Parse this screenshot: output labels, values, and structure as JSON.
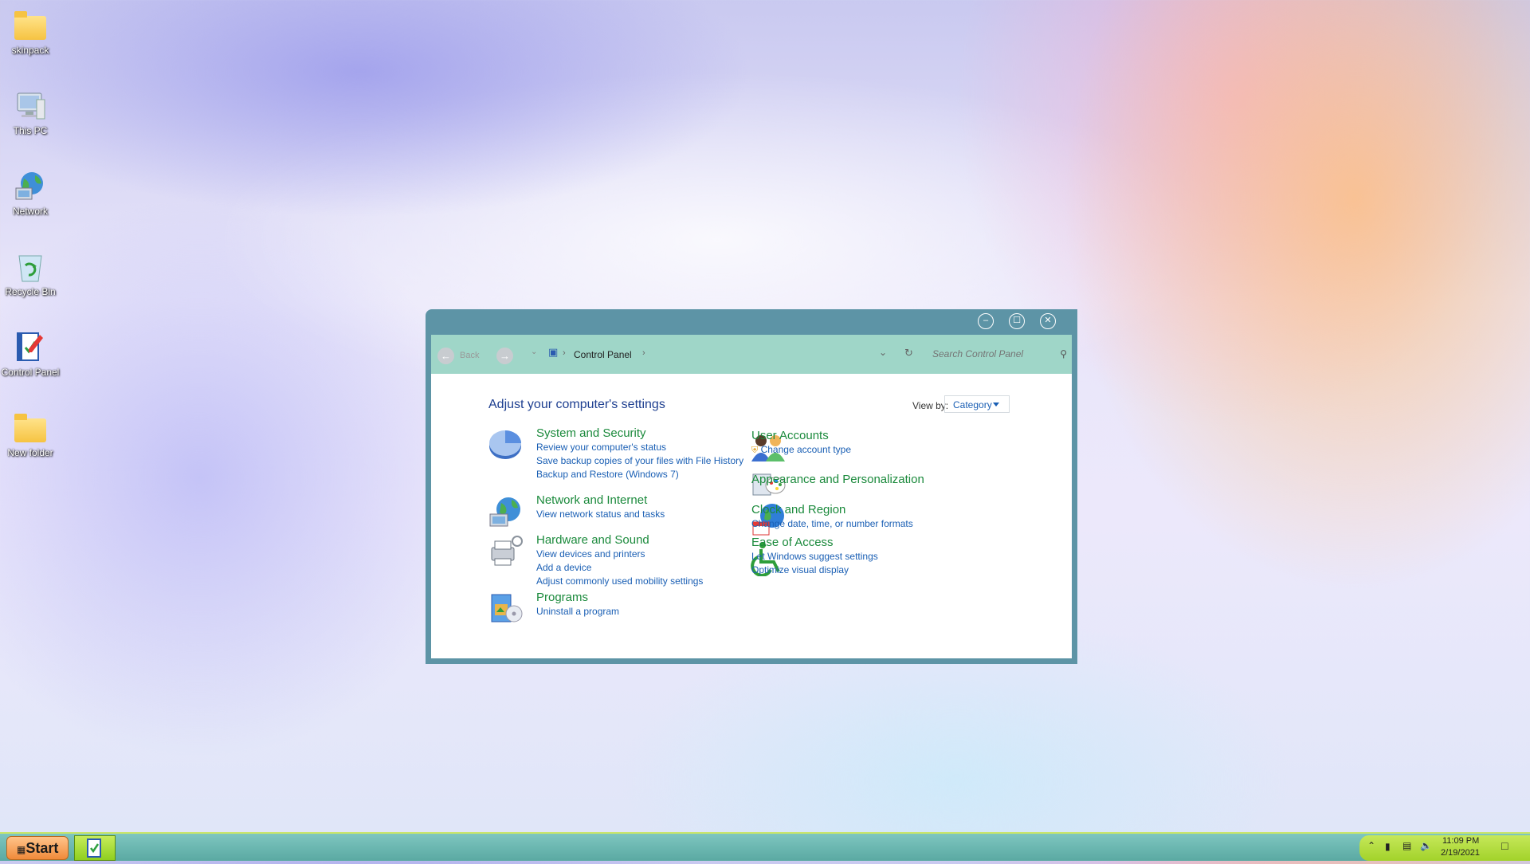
{
  "desktop": {
    "icons": [
      {
        "label": "skinpack",
        "icon": "folder-icon"
      },
      {
        "label": "This PC",
        "icon": "computer-icon"
      },
      {
        "label": "Network",
        "icon": "network-globe-icon"
      },
      {
        "label": "Recycle Bin",
        "icon": "recycle-bin-icon"
      },
      {
        "label": "Control Panel",
        "icon": "control-panel-icon"
      },
      {
        "label": "New folder",
        "icon": "folder-icon"
      }
    ]
  },
  "window": {
    "title_buttons": {
      "minimize": "–",
      "maximize": "☐",
      "close": "✕"
    },
    "nav": {
      "back_label": "Back",
      "breadcrumb": "Control Panel",
      "search_placeholder": "Search Control Panel"
    },
    "heading": "Adjust your computer's settings",
    "view_by_label": "View by:",
    "view_by_value": "Category",
    "categories_left": [
      {
        "title": "System and Security",
        "icon": "system-security-icon",
        "links": [
          "Review your computer's status",
          "Save backup copies of your files with File History",
          "Backup and Restore (Windows 7)"
        ]
      },
      {
        "title": "Network and Internet",
        "icon": "network-internet-icon",
        "links": [
          "View network status and tasks"
        ]
      },
      {
        "title": "Hardware and Sound",
        "icon": "hardware-sound-icon",
        "links": [
          "View devices and printers",
          "Add a device",
          "Adjust commonly used mobility settings"
        ]
      },
      {
        "title": "Programs",
        "icon": "programs-icon",
        "links": [
          "Uninstall a program"
        ]
      }
    ],
    "categories_right": [
      {
        "title": "User Accounts",
        "icon": "user-accounts-icon",
        "links": [
          "Change account type"
        ]
      },
      {
        "title": "Appearance and Personalization",
        "icon": "appearance-icon",
        "links": []
      },
      {
        "title": "Clock and Region",
        "icon": "clock-region-icon",
        "links": [
          "Change date, time, or number formats"
        ]
      },
      {
        "title": "Ease of Access",
        "icon": "ease-of-access-icon",
        "links": [
          "Let Windows suggest settings",
          "Optimize visual display"
        ]
      }
    ]
  },
  "taskbar": {
    "start_label": "Start",
    "time": "11:09 PM",
    "date": "2/19/2021"
  },
  "colors": {
    "accent": "#5d94a6",
    "nav": "#9fd6c8",
    "category_title": "#1b8a3c",
    "link": "#1a5fb4"
  }
}
